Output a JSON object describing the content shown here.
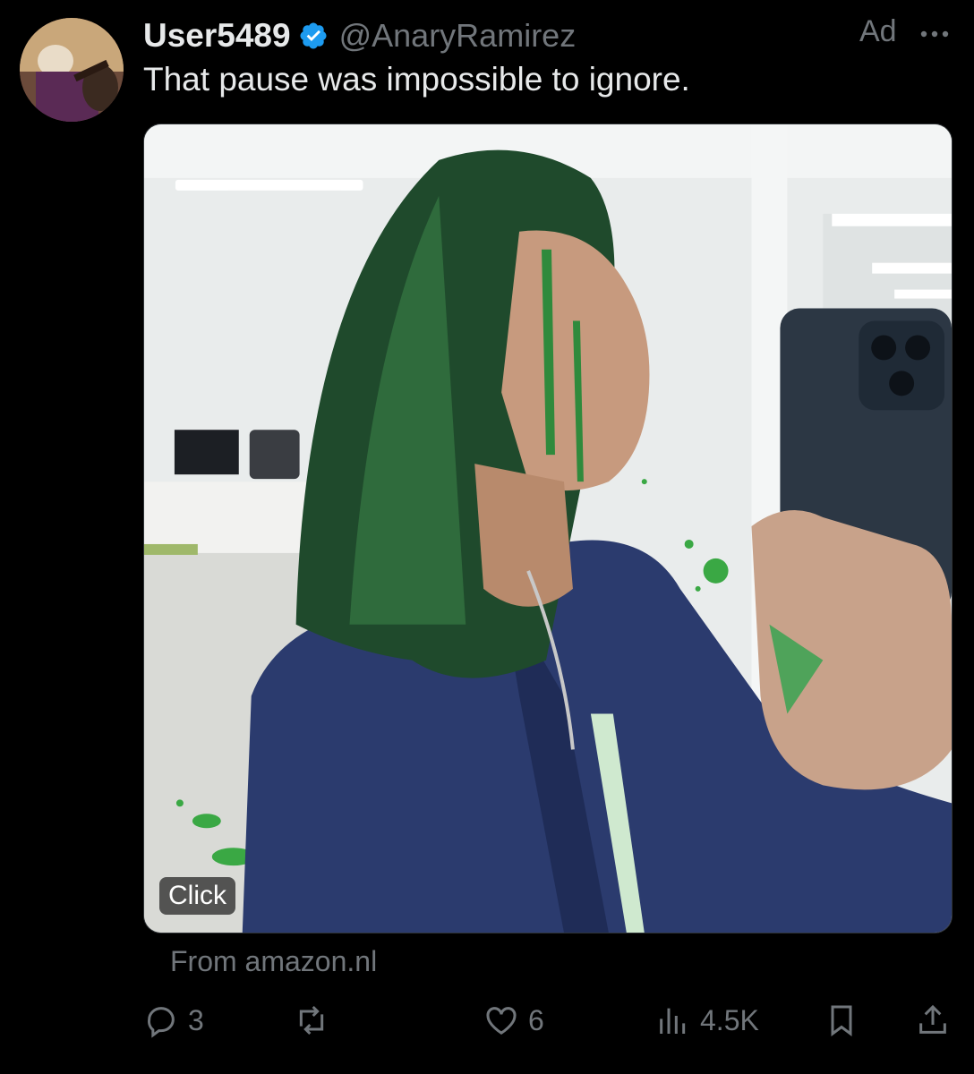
{
  "post": {
    "display_name": "User5489",
    "handle": "@AnaryRamirez",
    "ad_label": "Ad",
    "text": "That pause was impossible to ignore.",
    "media_badge": "Click",
    "source": "From amazon.nl"
  },
  "actions": {
    "replies": "3",
    "reposts": "",
    "likes": "6",
    "views": "4.5K"
  },
  "icons": {
    "verified": "verified-badge-icon",
    "more": "more-horizontal-icon",
    "reply": "reply-icon",
    "repost": "repost-icon",
    "like": "heart-icon",
    "views": "views-chart-icon",
    "bookmark": "bookmark-icon",
    "share": "share-icon"
  },
  "colors": {
    "background": "#000000",
    "text_primary": "#e7e9ea",
    "text_secondary": "#71767b",
    "verified_blue": "#1d9bf0"
  }
}
